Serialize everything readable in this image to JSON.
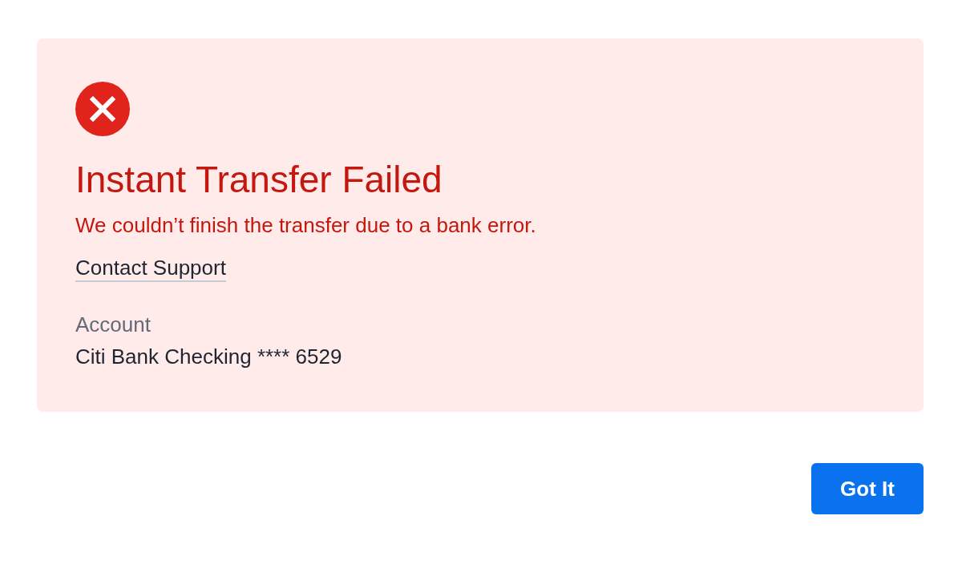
{
  "alert": {
    "title": "Instant Transfer Failed",
    "message": "We couldn’t finish the transfer due to a bank error.",
    "link": "Contact Support",
    "account_label": "Account",
    "account_value": "Citi Bank Checking **** 6529"
  },
  "buttons": [
    "Got It"
  ]
}
